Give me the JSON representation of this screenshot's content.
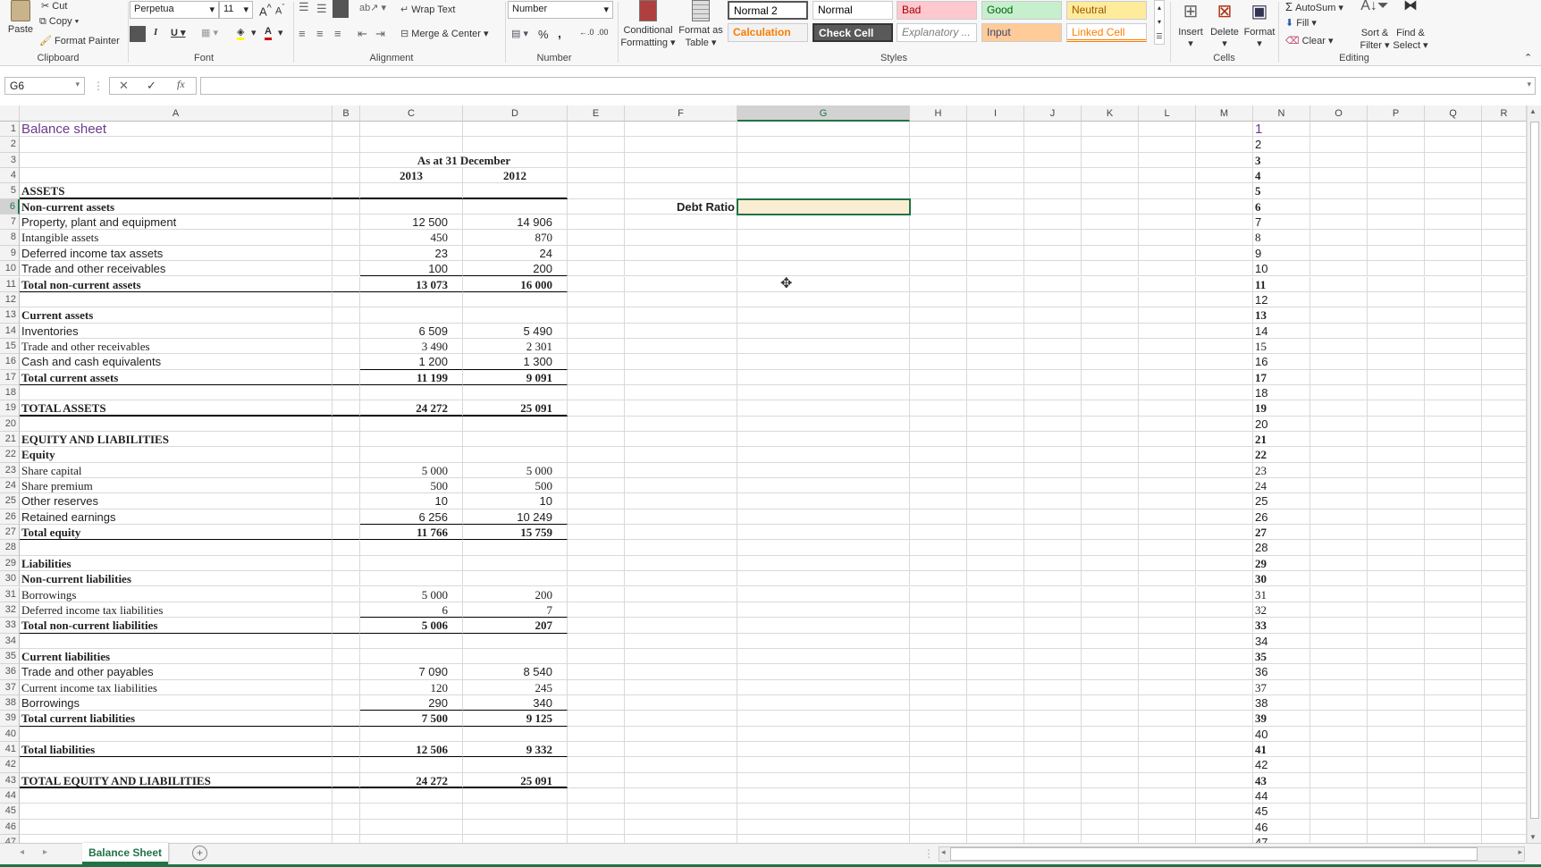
{
  "ribbon": {
    "clipboard": {
      "paste": "Paste",
      "cut": "Cut",
      "copy": "Copy",
      "format_painter": "Format Painter",
      "label": "Clipboard"
    },
    "font": {
      "name": "Perpetua",
      "size": "11",
      "label": "Font",
      "bold": "B",
      "italic": "I",
      "underline": "U"
    },
    "alignment": {
      "wrap_text": "Wrap Text",
      "merge_center": "Merge & Center",
      "label": "Alignment"
    },
    "number": {
      "format": "Number",
      "percent": "%",
      "comma": ",",
      "label": "Number"
    },
    "styles": {
      "conditional_formatting": "Conditional Formatting",
      "format_as_table": "Format as Table",
      "label": "Styles",
      "gallery": [
        {
          "name": "Normal 2",
          "bg": "#ffffff",
          "fg": "#000000"
        },
        {
          "name": "Normal",
          "bg": "#ffffff",
          "fg": "#000000"
        },
        {
          "name": "Bad",
          "bg": "#ffc7ce",
          "fg": "#9c0006"
        },
        {
          "name": "Good",
          "bg": "#c6efce",
          "fg": "#006100"
        },
        {
          "name": "Neutral",
          "bg": "#ffeb9c",
          "fg": "#9c5700"
        },
        {
          "name": "Calculation",
          "bg": "#f2f2f2",
          "fg": "#fa7d00"
        },
        {
          "name": "Check Cell",
          "bg": "#595959",
          "fg": "#ffffff"
        },
        {
          "name": "Explanatory ...",
          "bg": "#ffffff",
          "fg": "#7f7f7f"
        },
        {
          "name": "Input",
          "bg": "#ffcc99",
          "fg": "#3f3f76"
        },
        {
          "name": "Linked Cell",
          "bg": "#ffffff",
          "fg": "#fa7d00"
        }
      ]
    },
    "cells": {
      "insert": "Insert",
      "delete": "Delete",
      "format": "Format",
      "label": "Cells"
    },
    "editing": {
      "autosum": "AutoSum",
      "fill": "Fill",
      "clear": "Clear",
      "sort_filter": "Sort & Filter",
      "find_select": "Find & Select",
      "label": "Editing"
    }
  },
  "formula_bar": {
    "name_box": "G6",
    "formula": ""
  },
  "columns": [
    "A",
    "B",
    "C",
    "D",
    "E",
    "F",
    "G",
    "H",
    "I",
    "J",
    "K",
    "L",
    "M",
    "N",
    "O",
    "P",
    "Q",
    "R"
  ],
  "selected_cell": {
    "col": "G",
    "row": 6
  },
  "sheet": {
    "rows": [
      {
        "n": 1,
        "a": "Balance sheet",
        "kind": "title"
      },
      {
        "n": 2
      },
      {
        "n": 3,
        "c": "As at 31 December",
        "kind": "header"
      },
      {
        "n": 4,
        "c": "2013",
        "d": "2012",
        "kind": "header"
      },
      {
        "n": 5,
        "a": "ASSETS",
        "kind": "bold"
      },
      {
        "n": 6,
        "a": "Non-current assets",
        "kind": "bold",
        "f": "Debt Ratio"
      },
      {
        "n": 7,
        "a": "Property, plant and equipment",
        "c": "12 500",
        "d": "14 906"
      },
      {
        "n": 8,
        "a": "Intangible assets",
        "c": "450",
        "d": "870",
        "kind": "serif"
      },
      {
        "n": 9,
        "a": "Deferred income tax assets",
        "c": "23",
        "d": "24"
      },
      {
        "n": 10,
        "a": "Trade and other receivables",
        "c": "100",
        "d": "200"
      },
      {
        "n": 11,
        "a": "Total non-current assets",
        "c": "13 073",
        "d": "16 000",
        "kind": "bold"
      },
      {
        "n": 12
      },
      {
        "n": 13,
        "a": "Current assets",
        "kind": "bold"
      },
      {
        "n": 14,
        "a": "Inventories",
        "c": "6 509",
        "d": "5 490"
      },
      {
        "n": 15,
        "a": "Trade and other receivables",
        "c": "3 490",
        "d": "2 301",
        "kind": "serif"
      },
      {
        "n": 16,
        "a": "Cash and cash equivalents",
        "c": "1 200",
        "d": "1 300"
      },
      {
        "n": 17,
        "a": "Total current assets",
        "c": "11 199",
        "d": "9 091",
        "kind": "bold"
      },
      {
        "n": 18
      },
      {
        "n": 19,
        "a": "TOTAL ASSETS",
        "c": "24 272",
        "d": "25 091",
        "kind": "bold"
      },
      {
        "n": 20
      },
      {
        "n": 21,
        "a": "EQUITY AND LIABILITIES",
        "kind": "bold"
      },
      {
        "n": 22,
        "a": "Equity",
        "kind": "bold"
      },
      {
        "n": 23,
        "a": "Share capital",
        "c": "5 000",
        "d": "5 000",
        "kind": "serif"
      },
      {
        "n": 24,
        "a": "Share premium",
        "c": "500",
        "d": "500",
        "kind": "serif"
      },
      {
        "n": 25,
        "a": "Other reserves",
        "c": "10",
        "d": "10"
      },
      {
        "n": 26,
        "a": "Retained earnings",
        "c": "6 256",
        "d": "10 249"
      },
      {
        "n": 27,
        "a": "Total equity",
        "c": "11 766",
        "d": "15 759",
        "kind": "bold"
      },
      {
        "n": 28
      },
      {
        "n": 29,
        "a": "Liabilities",
        "kind": "bold"
      },
      {
        "n": 30,
        "a": "Non-current liabilities",
        "kind": "bold"
      },
      {
        "n": 31,
        "a": "Borrowings",
        "c": "5 000",
        "d": "200",
        "kind": "serif"
      },
      {
        "n": 32,
        "a": "Deferred income tax liabilities",
        "c": "6",
        "d": "7",
        "kind": "serif"
      },
      {
        "n": 33,
        "a": "Total non-current liabilities",
        "c": "5 006",
        "d": "207",
        "kind": "bold"
      },
      {
        "n": 34
      },
      {
        "n": 35,
        "a": "Current liabilities",
        "kind": "bold"
      },
      {
        "n": 36,
        "a": "Trade and other payables",
        "c": "7 090",
        "d": "8 540"
      },
      {
        "n": 37,
        "a": "Current income tax liabilities",
        "c": "120",
        "d": "245",
        "kind": "serif"
      },
      {
        "n": 38,
        "a": "Borrowings",
        "c": "290",
        "d": "340"
      },
      {
        "n": 39,
        "a": "Total current liabilities",
        "c": "7 500",
        "d": "9 125",
        "kind": "bold"
      },
      {
        "n": 40
      },
      {
        "n": 41,
        "a": "Total liabilities",
        "c": "12 506",
        "d": "9 332",
        "kind": "bold"
      },
      {
        "n": 42
      },
      {
        "n": 43,
        "a": "TOTAL EQUITY AND LIABILITIES",
        "c": "24 272",
        "d": "25 091",
        "kind": "bold"
      },
      {
        "n": 44
      },
      {
        "n": 45
      },
      {
        "n": 46
      },
      {
        "n": 47
      }
    ]
  },
  "tabs": {
    "active": "Balance Sheet",
    "add": "+"
  }
}
